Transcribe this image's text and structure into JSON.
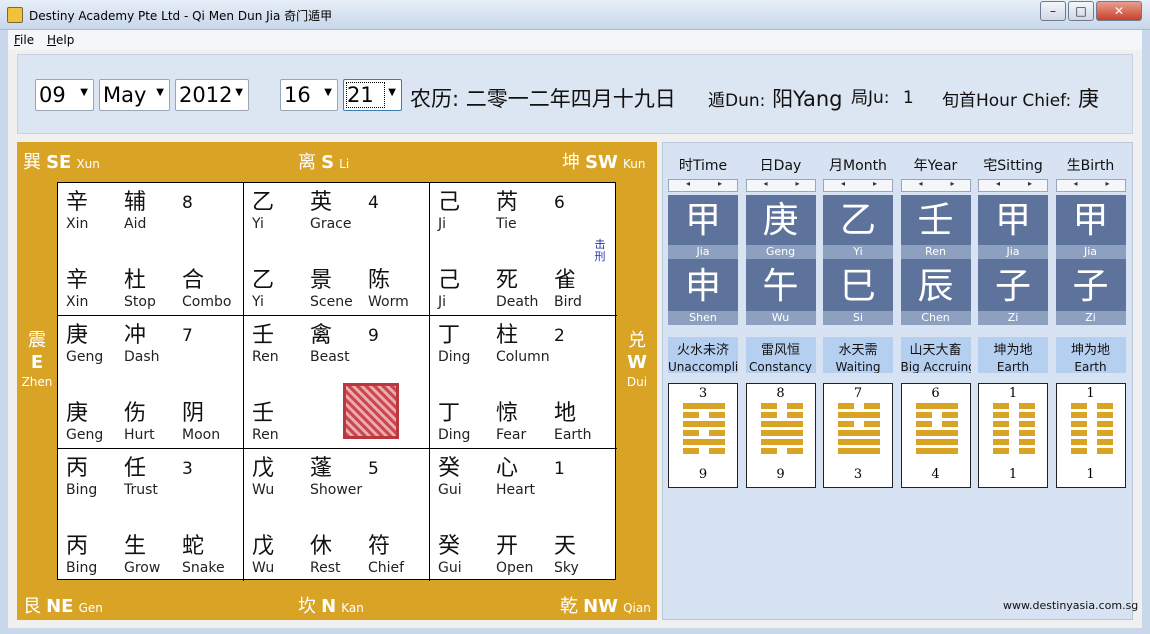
{
  "window": {
    "title": "Destiny Academy Pte Ltd - Qi Men Dun Jia 奇门遁甲",
    "minimize": "–",
    "maximize": "□",
    "close": "✕"
  },
  "menu": {
    "file": "File",
    "help": "Help"
  },
  "date": {
    "day": "09",
    "month": "May",
    "year": "2012",
    "hour": "16",
    "minute": "21"
  },
  "info": {
    "lunar_label": "农历:",
    "lunar_value": "二零一二年四月十九日",
    "dun_label": "遁Dun:",
    "dun_value": "阳Yang",
    "ju_label": "局Ju:",
    "ju_value": "1",
    "chief_label": "旬首Hour Chief:",
    "chief_value": "庚"
  },
  "directions": {
    "se": {
      "cn": "巽",
      "en": "SE",
      "py": "Xun"
    },
    "s": {
      "cn": "离",
      "en": "S",
      "py": "Li"
    },
    "sw": {
      "cn": "坤",
      "en": "SW",
      "py": "Kun"
    },
    "e": {
      "cn": "震",
      "en": "E",
      "py": "Zhen"
    },
    "w": {
      "cn": "兑",
      "en": "W",
      "py": "Dui"
    },
    "ne": {
      "cn": "艮",
      "en": "NE",
      "py": "Gen"
    },
    "n": {
      "cn": "坎",
      "en": "N",
      "py": "Kan"
    },
    "nw": {
      "cn": "乾",
      "en": "NW",
      "py": "Qian"
    }
  },
  "palaces": [
    {
      "stem1": "辛",
      "stem1_py": "Xin",
      "star": "辅",
      "star_en": "Aid",
      "num": "8",
      "stem2": "辛",
      "stem2_py": "Xin",
      "door": "杜",
      "door_en": "Stop",
      "god": "合",
      "god_en": "Combo",
      "note": ""
    },
    {
      "stem1": "乙",
      "stem1_py": "Yi",
      "star": "英",
      "star_en": "Grace",
      "num": "4",
      "stem2": "乙",
      "stem2_py": "Yi",
      "door": "景",
      "door_en": "Scene",
      "god": "陈",
      "god_en": "Worm",
      "note": ""
    },
    {
      "stem1": "己",
      "stem1_py": "Ji",
      "star": "芮",
      "star_en": "Tie",
      "num": "6",
      "stem2": "己",
      "stem2_py": "Ji",
      "door": "死",
      "door_en": "Death",
      "god": "雀",
      "god_en": "Bird",
      "note": "击刑"
    },
    {
      "stem1": "庚",
      "stem1_py": "Geng",
      "star": "冲",
      "star_en": "Dash",
      "num": "7",
      "stem2": "庚",
      "stem2_py": "Geng",
      "door": "伤",
      "door_en": "Hurt",
      "god": "阴",
      "god_en": "Moon",
      "note": ""
    },
    {
      "stem1": "壬",
      "stem1_py": "Ren",
      "star": "禽",
      "star_en": "Beast",
      "num": "9",
      "stem2": "壬",
      "stem2_py": "Ren",
      "door": "",
      "door_en": "",
      "god": "",
      "god_en": "",
      "note": ""
    },
    {
      "stem1": "丁",
      "stem1_py": "Ding",
      "star": "柱",
      "star_en": "Column",
      "num": "2",
      "stem2": "丁",
      "stem2_py": "Ding",
      "door": "惊",
      "door_en": "Fear",
      "god": "地",
      "god_en": "Earth",
      "note": ""
    },
    {
      "stem1": "丙",
      "stem1_py": "Bing",
      "star": "任",
      "star_en": "Trust",
      "num": "3",
      "stem2": "丙",
      "stem2_py": "Bing",
      "door": "生",
      "door_en": "Grow",
      "god": "蛇",
      "god_en": "Snake",
      "note": ""
    },
    {
      "stem1": "戊",
      "stem1_py": "Wu",
      "star": "蓬",
      "star_en": "Shower",
      "num": "5",
      "stem2": "戊",
      "stem2_py": "Wu",
      "door": "休",
      "door_en": "Rest",
      "god": "符",
      "god_en": "Chief",
      "note": ""
    },
    {
      "stem1": "癸",
      "stem1_py": "Gui",
      "star": "心",
      "star_en": "Heart",
      "num": "1",
      "stem2": "癸",
      "stem2_py": "Gui",
      "door": "开",
      "door_en": "Open",
      "god": "天",
      "god_en": "Sky",
      "note": ""
    }
  ],
  "pillars": [
    {
      "title": "时Time",
      "stem": "甲",
      "stem_py": "Jia",
      "branch": "申",
      "branch_py": "Shen",
      "hex_cn": "火水未济",
      "hex_en": "Unaccomplished",
      "top": "3",
      "bottom": "9",
      "lines": [
        1,
        0,
        1,
        0,
        1,
        0
      ]
    },
    {
      "title": "日Day",
      "stem": "庚",
      "stem_py": "Geng",
      "branch": "午",
      "branch_py": "Wu",
      "hex_cn": "雷风恒",
      "hex_en": "Constancy",
      "top": "8",
      "bottom": "9",
      "lines": [
        0,
        0,
        1,
        1,
        1,
        0
      ]
    },
    {
      "title": "月Month",
      "stem": "乙",
      "stem_py": "Yi",
      "branch": "巳",
      "branch_py": "Si",
      "hex_cn": "水天需",
      "hex_en": "Waiting",
      "top": "7",
      "bottom": "3",
      "lines": [
        0,
        1,
        0,
        1,
        1,
        1
      ]
    },
    {
      "title": "年Year",
      "stem": "壬",
      "stem_py": "Ren",
      "branch": "辰",
      "branch_py": "Chen",
      "hex_cn": "山天大畜",
      "hex_en": "Big Accruing",
      "top": "6",
      "bottom": "4",
      "lines": [
        1,
        0,
        0,
        1,
        1,
        1
      ]
    },
    {
      "title": "宅Sitting",
      "stem": "甲",
      "stem_py": "Jia",
      "branch": "子",
      "branch_py": "Zi",
      "hex_cn": "坤为地",
      "hex_en": "Earth",
      "top": "1",
      "bottom": "1",
      "lines": [
        0,
        0,
        0,
        0,
        0,
        0
      ]
    },
    {
      "title": "生Birth",
      "stem": "甲",
      "stem_py": "Jia",
      "branch": "子",
      "branch_py": "Zi",
      "hex_cn": "坤为地",
      "hex_en": "Earth",
      "top": "1",
      "bottom": "1",
      "lines": [
        0,
        0,
        0,
        0,
        0,
        0
      ]
    }
  ],
  "spin": {
    "left": "◂",
    "right": "▸"
  },
  "website": "www.destinyasia.com.sg",
  "colors": {
    "gold": "#d9a425",
    "slate": "#5d739c"
  }
}
